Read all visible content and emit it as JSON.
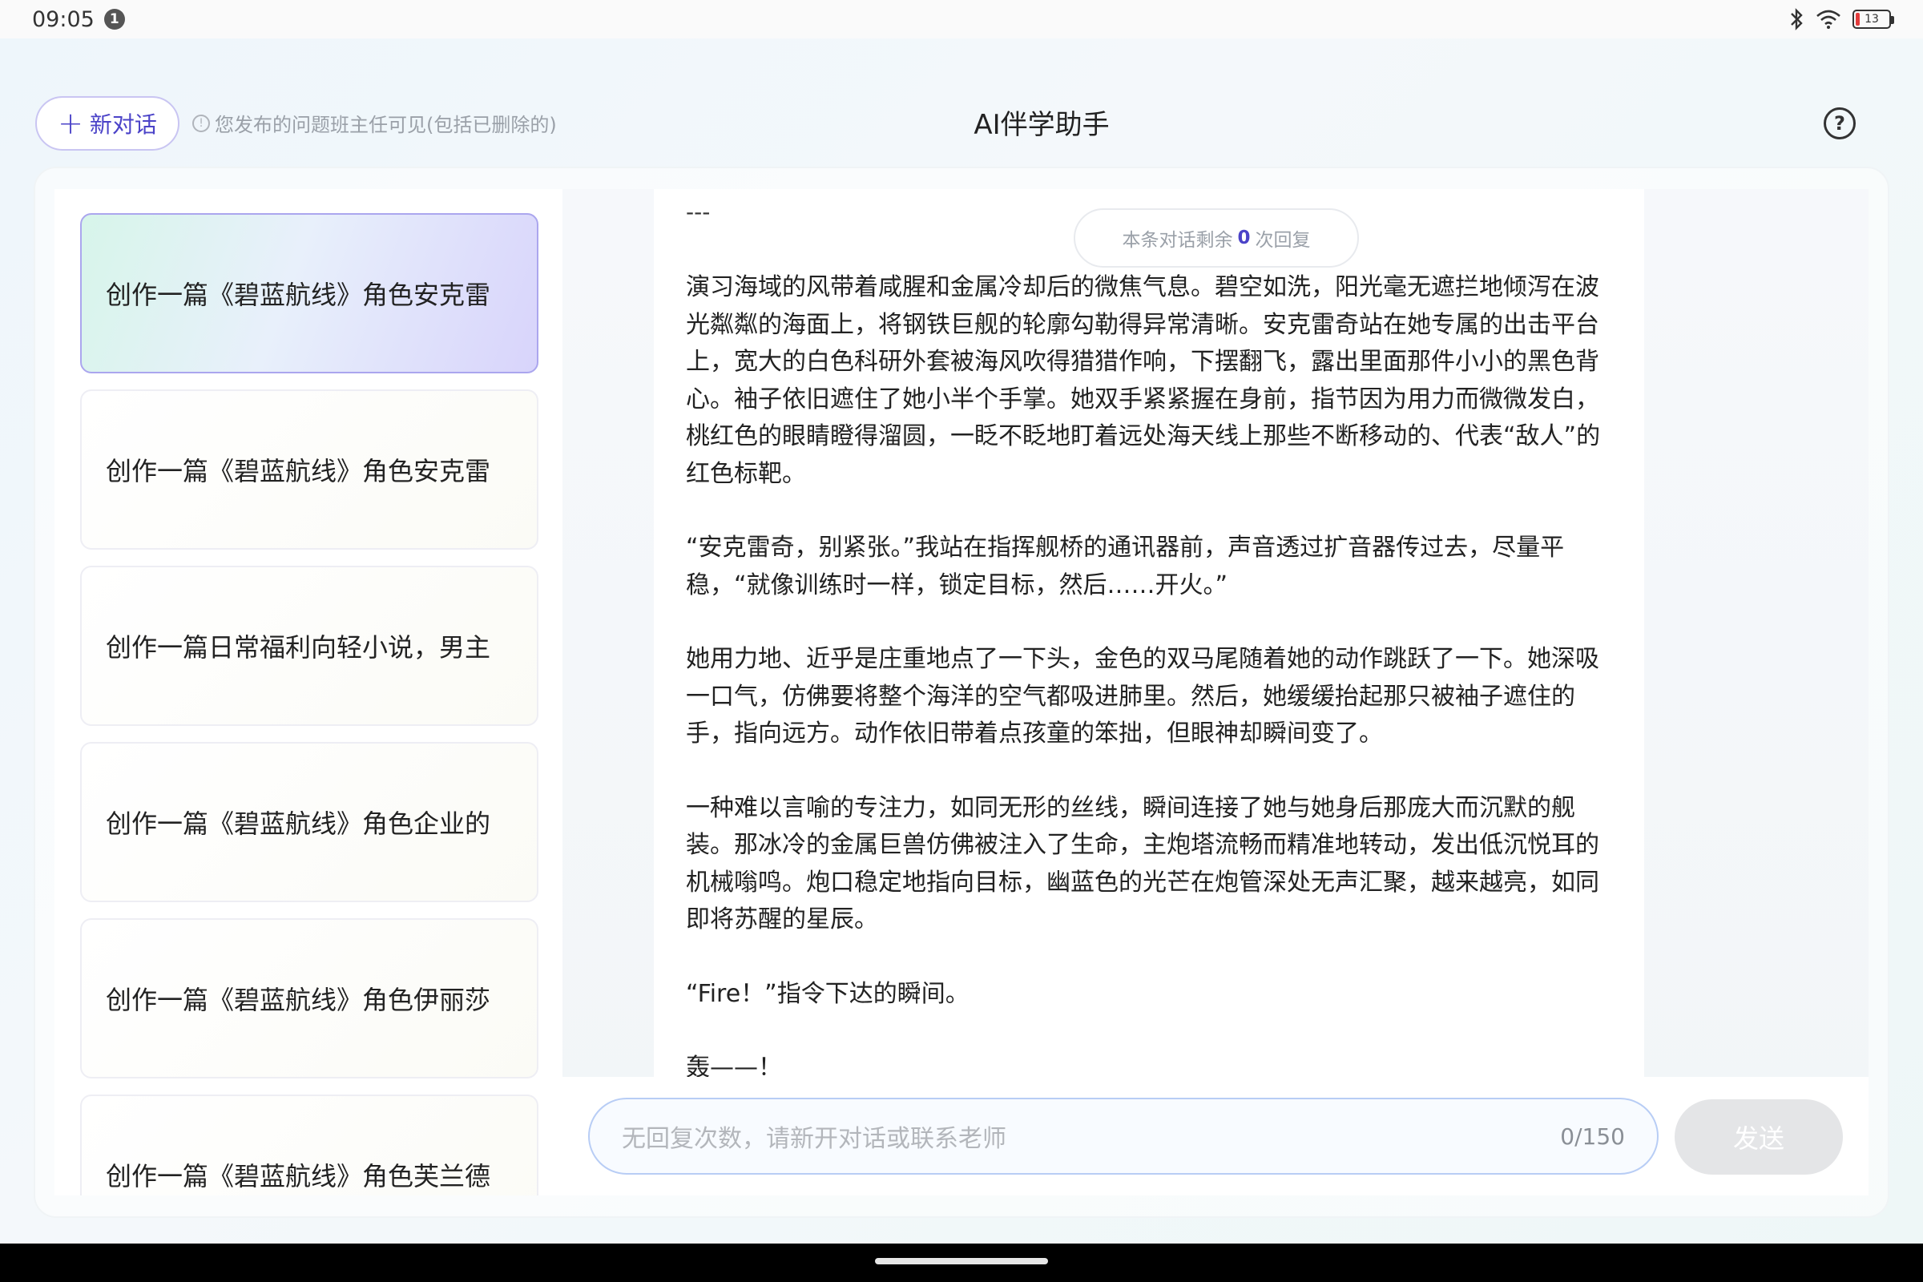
{
  "status": {
    "time": "09:05",
    "notification_count": "1",
    "battery": "13",
    "battery_level": 0.13,
    "icons": [
      "bluetooth-icon",
      "wifi-icon",
      "battery-icon"
    ]
  },
  "header": {
    "new_chat_label": "新对话",
    "notice": "您发布的问题班主任可见(包括已删除的)",
    "title": "AI伴学助手"
  },
  "sidebar": {
    "items": [
      {
        "label": "创作一篇《碧蓝航线》角色安克雷"
      },
      {
        "label": "创作一篇《碧蓝航线》角色安克雷"
      },
      {
        "label": "创作一篇日常福利向轻小说，男主"
      },
      {
        "label": "创作一篇《碧蓝航线》角色企业的"
      },
      {
        "label": "创作一篇《碧蓝航线》角色伊丽莎"
      },
      {
        "label": "创作一篇《碧蓝航线》角色芙兰德"
      }
    ]
  },
  "chat": {
    "remaining_prefix": "本条对话剩余",
    "remaining_count": "0",
    "remaining_suffix": "次回复",
    "dash": "---",
    "paragraphs": [
      "演习海域的风带着咸腥和金属冷却后的微焦气息。碧空如洗，阳光毫无遮拦地倾泻在波光粼粼的海面上，将钢铁巨舰的轮廓勾勒得异常清晰。安克雷奇站在她专属的出击平台上，宽大的白色科研外套被海风吹得猎猎作响，下摆翻飞，露出里面那件小小的黑色背心。袖子依旧遮住了她小半个手掌。她双手紧紧握在身前，指节因为用力而微微发白，桃红色的眼睛瞪得溜圆，一眨不眨地盯着远处海天线上那些不断移动的、代表“敌人”的红色标靶。",
      "“安克雷奇，别紧张。”我站在指挥舰桥的通讯器前，声音透过扩音器传过去，尽量平稳，“就像训练时一样，锁定目标，然后……开火。”",
      "她用力地、近乎是庄重地点了一下头，金色的双马尾随着她的动作跳跃了一下。她深吸一口气，仿佛要将整个海洋的空气都吸进肺里。然后，她缓缓抬起那只被袖子遮住的手，指向远方。动作依旧带着点孩童的笨拙，但眼神却瞬间变了。",
      "一种难以言喻的专注力，如同无形的丝线，瞬间连接了她与她身后那庞大而沉默的舰装。那冰冷的金属巨兽仿佛被注入了生命，主炮塔流畅而精准地转动，发出低沉悦耳的机械嗡鸣。炮口稳定地指向目标，幽蓝色的光芒在炮管深处无声汇聚，越来越亮，如同即将苏醒的星辰。",
      "“Fire！”指令下达的瞬间。",
      "轰——！"
    ]
  },
  "input": {
    "placeholder": "无回复次数，请新开对话或联系老师",
    "counter": "0/150",
    "send_label": "发送"
  }
}
